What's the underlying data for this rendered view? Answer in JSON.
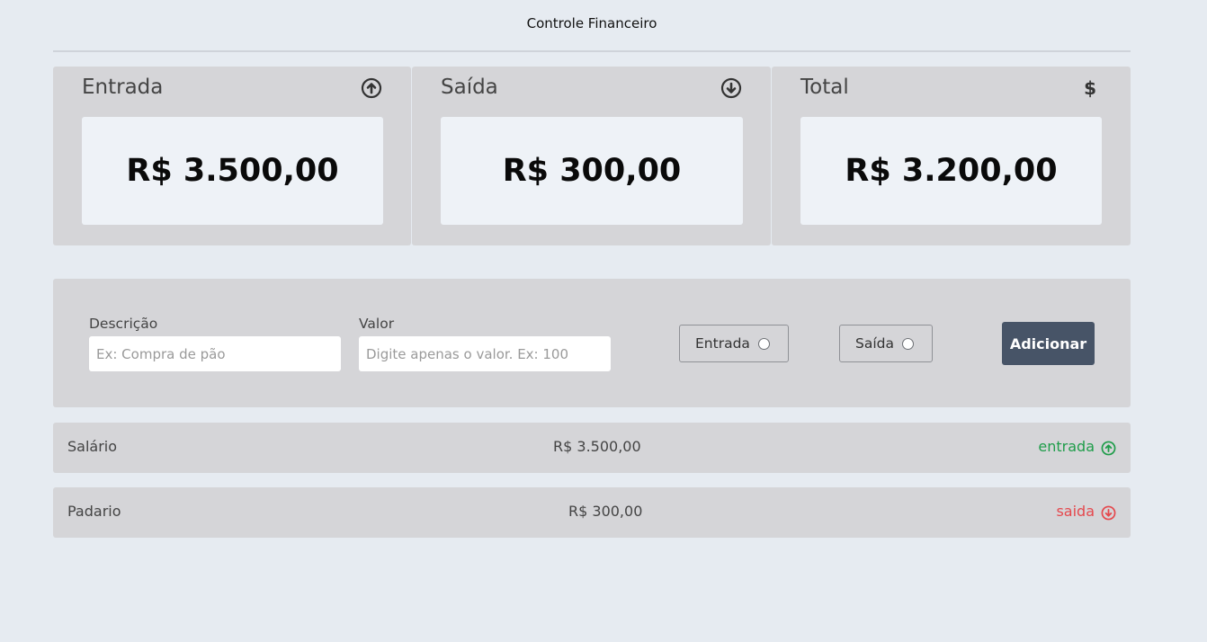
{
  "app": {
    "title": "Controle Financeiro"
  },
  "summary": {
    "income": {
      "title": "Entrada",
      "value": "R$ 3.500,00",
      "icon": "arrow-up-circle-icon"
    },
    "expense": {
      "title": "Saída",
      "value": "R$ 300,00",
      "icon": "arrow-down-circle-icon"
    },
    "total": {
      "title": "Total",
      "value": "R$ 3.200,00",
      "icon": "dollar-icon",
      "icon_text": "$"
    }
  },
  "form": {
    "description_label": "Descrição",
    "description_placeholder": "Ex: Compra de pão",
    "description_value": "",
    "value_label": "Valor",
    "value_placeholder": "Digite apenas o valor. Ex: 100",
    "value_value": "",
    "income_option": "Entrada",
    "expense_option": "Saída",
    "add_button": "Adicionar"
  },
  "transactions": [
    {
      "description": "Salário",
      "value": "R$ 3.500,00",
      "type": "entrada",
      "icon": "arrow-up-circle-icon"
    },
    {
      "description": "Padario",
      "value": "R$ 300,00",
      "type": "saida",
      "icon": "arrow-down-circle-icon"
    }
  ],
  "colors": {
    "background": "#e6ebf1",
    "card": "#d5d5d8",
    "value_box": "#eef2f7",
    "button": "#475467",
    "income": "#1f9d4a",
    "expense": "#e5484d"
  }
}
